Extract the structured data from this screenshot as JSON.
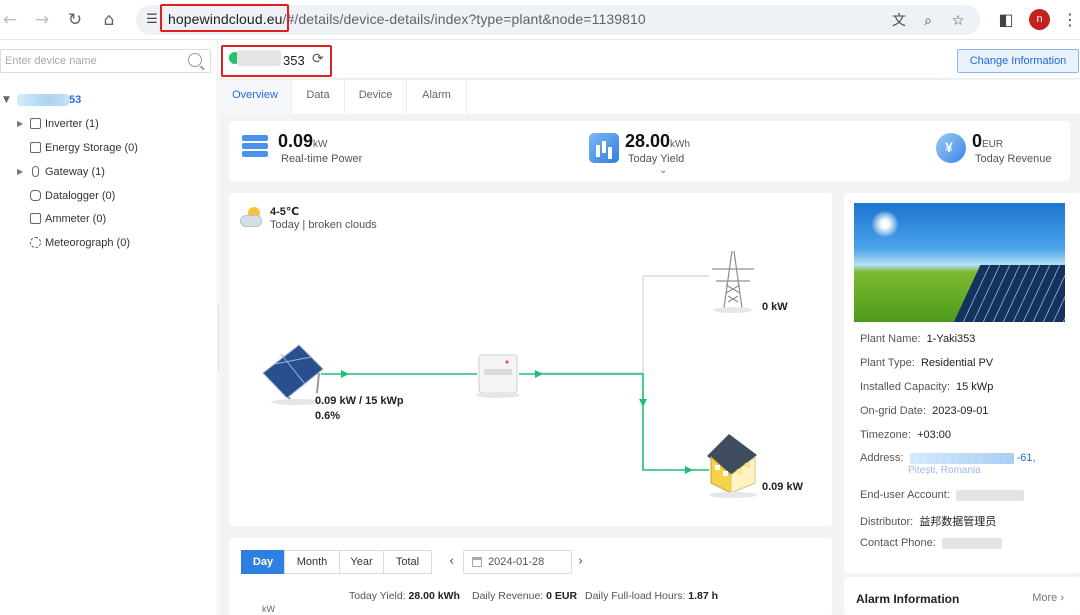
{
  "browser": {
    "url_domain": "hopewindcloud.eu",
    "url_path": "/#/details/device-details/index?type=plant&node=1139810",
    "profile_initial": "n"
  },
  "sidebar": {
    "search_placeholder": "Enter device name",
    "root_suffix": "53",
    "items": [
      {
        "label": "Inverter (1)",
        "icon": "inverter-icon",
        "expandable": true
      },
      {
        "label": "Energy Storage (0)",
        "icon": "battery-icon",
        "expandable": false
      },
      {
        "label": "Gateway (1)",
        "icon": "gateway-icon",
        "expandable": true
      },
      {
        "label": "Datalogger (0)",
        "icon": "datalogger-icon",
        "expandable": false
      },
      {
        "label": "Ammeter (0)",
        "icon": "ammeter-icon",
        "expandable": false
      },
      {
        "label": "Meteorograph (0)",
        "icon": "meteorograph-icon",
        "expandable": false
      }
    ]
  },
  "header": {
    "plant_name_suffix": "353",
    "change_button": "Change Information"
  },
  "tabs": [
    "Overview",
    "Data",
    "Device",
    "Alarm"
  ],
  "summary": {
    "power_value": "0.09",
    "power_unit": "kW",
    "power_label": "Real-time Power",
    "yield_value": "28.00",
    "yield_unit": "kWh",
    "yield_label": "Today Yield",
    "revenue_value": "0",
    "revenue_unit": "EUR",
    "revenue_label": "Today Revenue"
  },
  "weather": {
    "temp": "4-5℃",
    "desc": "Today | broken clouds"
  },
  "flow": {
    "pv_power": "0.09 kW / 15 kWp",
    "pv_ratio": "0.6%",
    "grid_power": "0 kW",
    "home_power": "0.09 kW"
  },
  "plant_info": {
    "name_label": "Plant Name:",
    "name_value": "1-Yaki353",
    "type_label": "Plant Type:",
    "type_value": "Residential PV",
    "capacity_label": "Installed Capacity:",
    "capacity_value": "15 kWp",
    "ongrid_label": "On-grid Date:",
    "ongrid_value": "2023-09-01",
    "timezone_label": "Timezone:",
    "timezone_value": "+03:00",
    "address_label": "Address:",
    "address_value": "-61,",
    "address_line2": "Pitești, Romania",
    "enduser_label": "End-user Account:",
    "distributor_label": "Distributor:",
    "distributor_value": "益邦数据管理员",
    "phone_label": "Contact Phone:"
  },
  "alarm": {
    "title": "Alarm Information",
    "more": "More"
  },
  "yield_panel": {
    "periods": [
      "Day",
      "Month",
      "Year",
      "Total"
    ],
    "active_period": "Day",
    "date": "2024-01-28",
    "today_yield_label": "Today Yield:",
    "today_yield_value": "28.00 kWh",
    "daily_revenue_label": "Daily Revenue:",
    "daily_revenue_value": "0 EUR",
    "full_load_label": "Daily Full-load Hours:",
    "full_load_value": "1.87 h",
    "y_unit": "kW"
  },
  "colors": {
    "accent": "#2f7fe0",
    "flow_line": "#1dbf73",
    "highlight": "#e02020"
  }
}
